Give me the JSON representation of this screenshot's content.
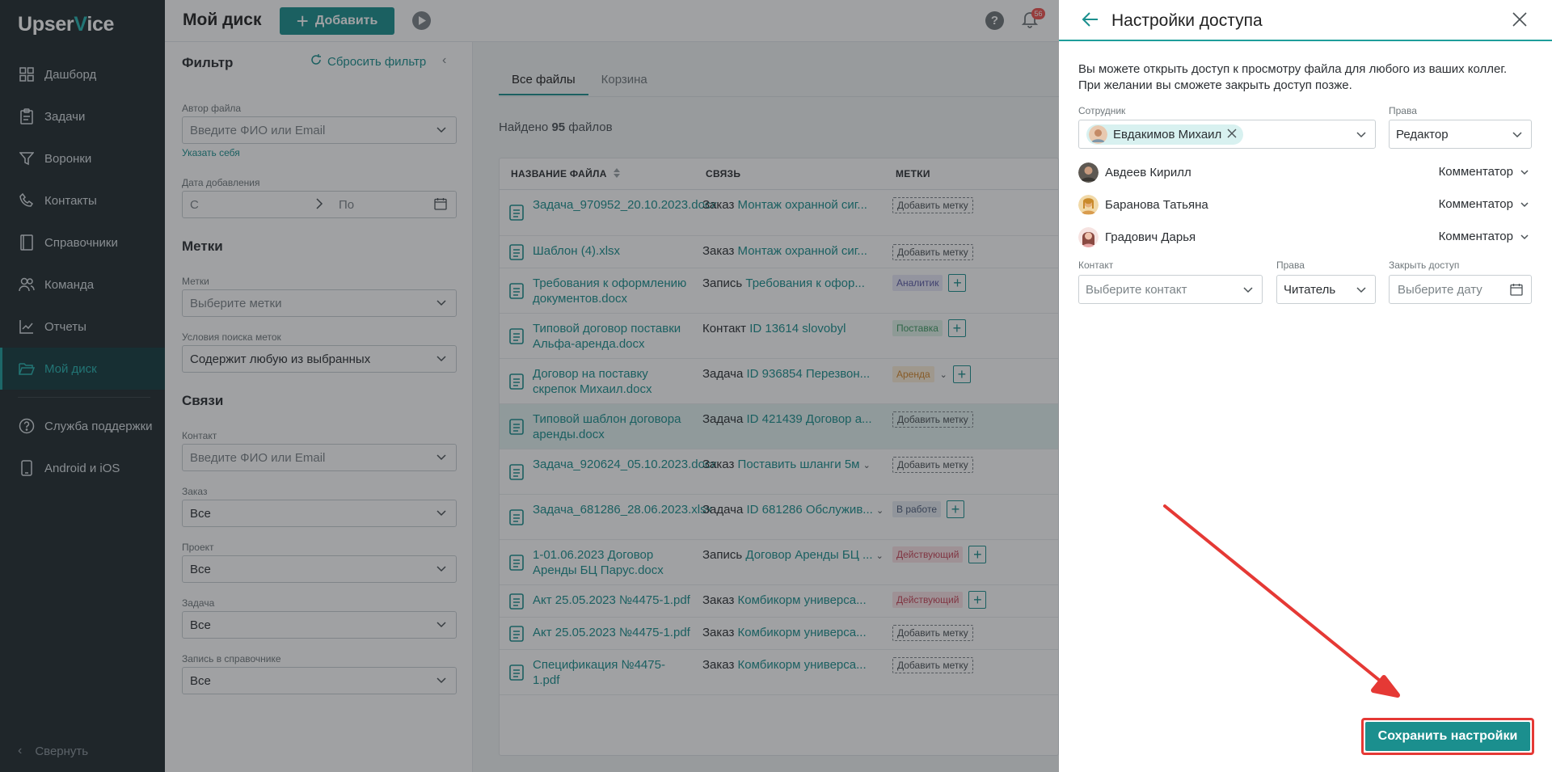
{
  "sidebar": {
    "logo_left": "Upser",
    "logo_v": "V",
    "logo_right": "ice",
    "items": [
      {
        "label": "Дашборд",
        "icon": "grid-icon"
      },
      {
        "label": "Задачи",
        "icon": "clipboard-icon"
      },
      {
        "label": "Воронки",
        "icon": "funnel-icon"
      },
      {
        "label": "Контакты",
        "icon": "phone-icon"
      },
      {
        "label": "Справочники",
        "icon": "book-icon"
      },
      {
        "label": "Команда",
        "icon": "team-icon"
      },
      {
        "label": "Отчеты",
        "icon": "chart-icon"
      },
      {
        "label": "Мой диск",
        "icon": "folder-icon",
        "active": true
      }
    ],
    "extra": [
      {
        "label": "Служба поддержки",
        "icon": "help-circle-icon"
      },
      {
        "label": "Android и iOS",
        "icon": "mobile-icon"
      }
    ],
    "collapse_label": "Свернуть"
  },
  "header": {
    "title": "Мой диск",
    "add_label": "Добавить",
    "notifications_count": "56"
  },
  "filter": {
    "title": "Фильтр",
    "reset_label": "Сбросить фильтр",
    "author_label": "Автор файла",
    "author_placeholder": "Введите ФИО или Email",
    "self_link": "Указать себя",
    "date_label": "Дата добавления",
    "date_from": "С",
    "date_to": "По",
    "tags_section": "Метки",
    "tags_label": "Метки",
    "tags_placeholder": "Выберите метки",
    "tag_cond_label": "Условия поиска меток",
    "tag_cond_value": "Содержит любую из выбранных",
    "links_section": "Связи",
    "contact_label": "Контакт",
    "contact_placeholder": "Введите ФИО или Email",
    "order_label": "Заказ",
    "order_value": "Все",
    "project_label": "Проект",
    "project_value": "Все",
    "task_label": "Задача",
    "task_value": "Все",
    "record_label": "Запись в справочнике",
    "record_value": "Все"
  },
  "files": {
    "tabs": [
      "Все файлы",
      "Корзина"
    ],
    "found_prefix": "Найдено ",
    "found_count": "95",
    "found_suffix": " файлов",
    "columns": [
      "НАЗВАНИЕ ФАЙЛА",
      "СВЯЗЬ",
      "МЕТКИ"
    ],
    "rows": [
      {
        "name": "Задача_970952_20.10.2023.docx",
        "link_type": "Заказ",
        "link_value": "Монтаж охранной сиг...",
        "tag": "Добавить метку",
        "tag_kind": "add"
      },
      {
        "name": "Шаблон (4).xlsx",
        "link_type": "Заказ",
        "link_value": "Монтаж охранной сиг...",
        "tag": "Добавить метку",
        "tag_kind": "add"
      },
      {
        "name": "Требования к оформлению документов.docx",
        "link_type": "Запись",
        "link_value": "Требования к офор...",
        "tag": "Аналитик",
        "tag_kind": "a1"
      },
      {
        "name": "Типовой договор поставки Альфа-аренда.docx",
        "link_type": "Контакт",
        "link_value": "ID 13614 slovobyl",
        "tag": "Поставка",
        "tag_kind": "a2"
      },
      {
        "name": "Договор на поставку скрепок Михаил.docx",
        "link_type": "Задача",
        "link_value": "ID 936854 Перезвон...",
        "tag": "Аренда",
        "tag_kind": "a3"
      },
      {
        "name": "Типовой шаблон договора аренды.docx",
        "link_type": "Задача",
        "link_value": "ID 421439 Договор а...",
        "tag": "Добавить метку",
        "tag_kind": "add"
      },
      {
        "name": "Задача_920624_05.10.2023.docx",
        "link_type": "Заказ",
        "link_value": "Поставить шланги 5м",
        "tag": "Добавить метку",
        "tag_kind": "add"
      },
      {
        "name": "Задача_681286_28.06.2023.xlsx",
        "link_type": "Задача",
        "link_value": "ID 681286 Обслужив...",
        "tag": "В работе",
        "tag_kind": "a4"
      },
      {
        "name": "1-01.06.2023 Договор Аренды БЦ Парус.docx",
        "link_type": "Запись",
        "link_value": "Договор Аренды БЦ ...",
        "tag": "Действующий",
        "tag_kind": "a5"
      },
      {
        "name": "Акт 25.05.2023 №4475-1.pdf",
        "link_type": "Заказ",
        "link_value": "Комбикорм универса...",
        "tag": "Действующий",
        "tag_kind": "a5"
      },
      {
        "name": "Акт 25.05.2023 №4475-1.pdf",
        "link_type": "Заказ",
        "link_value": "Комбикорм универса...",
        "tag": "Добавить метку",
        "tag_kind": "add"
      },
      {
        "name": "Спецификация №4475-1.pdf",
        "link_type": "Заказ",
        "link_value": "Комбикорм универса...",
        "tag": "Добавить метку",
        "tag_kind": "add"
      }
    ]
  },
  "panel": {
    "title": "Настройки доступа",
    "desc_line1": "Вы можете открыть доступ к просмотру файла для любого из ваших коллег.",
    "desc_line2": "При желании вы сможете закрыть доступ позже.",
    "employee_label": "Сотрудник",
    "employee_chip": "Евдакимов Михаил",
    "rights_label": "Права",
    "rights_value": "Редактор",
    "people": [
      {
        "name": "Авдеев Кирилл",
        "role": "Комментатор"
      },
      {
        "name": "Баранова Татьяна",
        "role": "Комментатор"
      },
      {
        "name": "Градович Дарья",
        "role": "Комментатор"
      }
    ],
    "contact_label": "Контакт",
    "contact_placeholder": "Выберите контакт",
    "rights2_label": "Права",
    "rights2_value": "Читатель",
    "close_access_label": "Закрыть доступ",
    "date_placeholder": "Выберите дату",
    "save_label": "Сохранить настройки"
  },
  "colors": {
    "accent": "#1b8f8e",
    "sidebar_bg": "#222b2f",
    "highlight": "#e53935"
  }
}
